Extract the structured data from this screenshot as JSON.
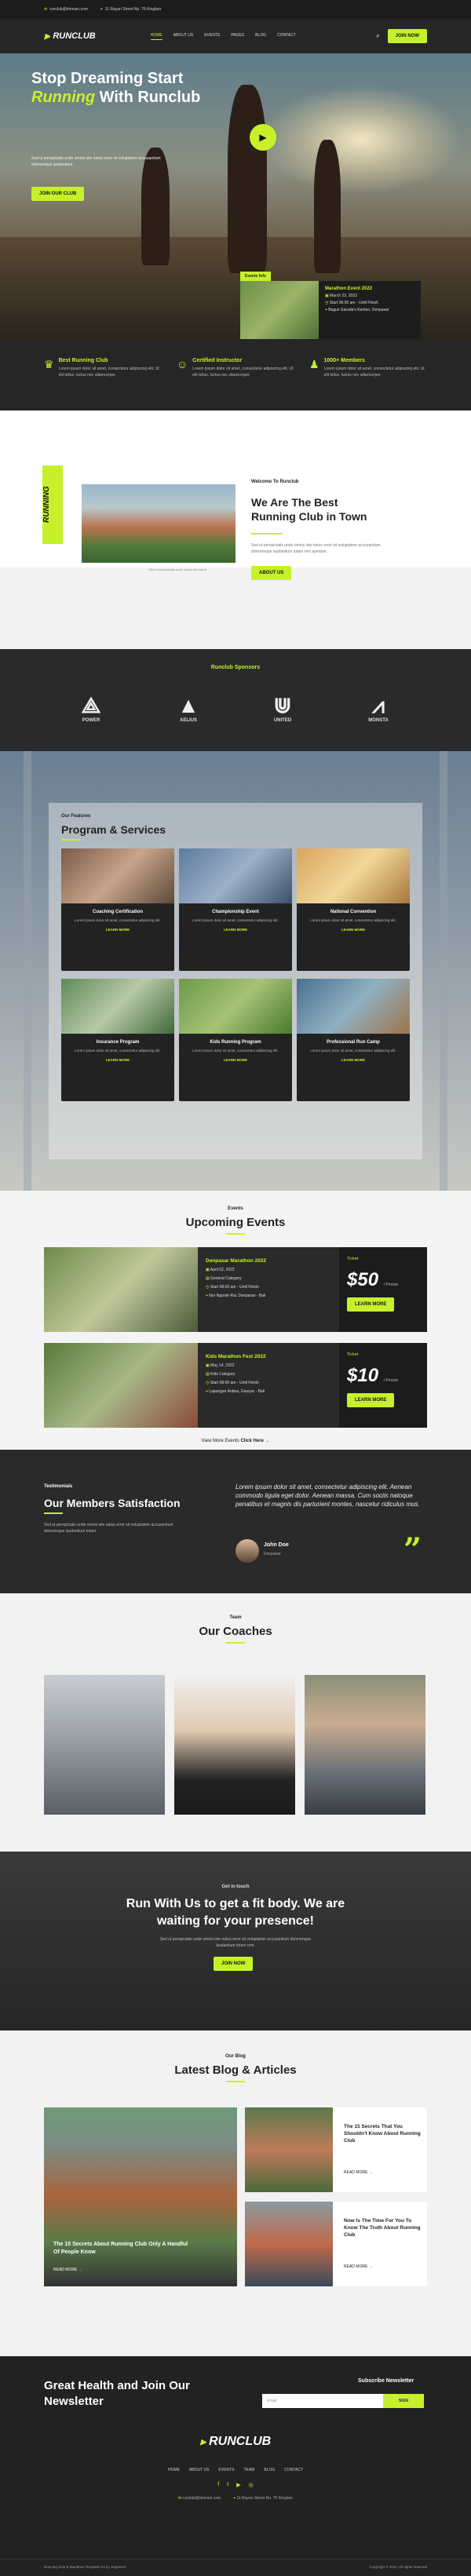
{
  "topbar": {
    "email": "runclub@domain.com",
    "address": "11 Rayan Street No. 76 Kinglaro"
  },
  "nav": {
    "logo": "RUNCLUB",
    "items": [
      "HOME",
      "ABOUT US",
      "EVENTS",
      "PAGES",
      "BLOG",
      "CONTACT"
    ],
    "cta": "JOIN NOW"
  },
  "hero": {
    "title_a": "Stop Dreaming Start",
    "title_em": "Running",
    "title_b": "With Runclub",
    "desc": "Sed ut perspiciatis unde omnis iste natus error sit voluptatem accusantium doloremque laudantium.",
    "button": "JOIN OUR CLUB"
  },
  "event_card": {
    "tag": "Events Info",
    "title": "Marathon Event 2022",
    "date": "March 23, 2022",
    "time": "Start 06:00 am - Until Finish",
    "place": "Bagus Garuda's Kenten, Denpasar"
  },
  "features": [
    {
      "title": "Best Running Club",
      "desc": "Lorem ipsum dolor sit amet, consectetur adipiscing elit. Ut elit tellus, luctus nec ullamcorper."
    },
    {
      "title": "Certified Instructor",
      "desc": "Lorem ipsum dolor sit amet, consectetur adipiscing elit. Ut elit tellus, luctus nec ullamcorper."
    },
    {
      "title": "1000+ Members",
      "desc": "Lorem ipsum dolor sit amet, consectetur adipiscing elit. Ut elit tellus, luctus nec ullamcorper."
    }
  ],
  "about": {
    "vertical": "RUNNING",
    "small": "Welcome To Runclub",
    "title": "We Are The Best Running Club in Town",
    "desc": "Sed ut perspiciatis unde omnis iste natus error sit voluptatem accusantium doloremque laudantium totam rem aperiam.",
    "caption": "Sed ut perspiciatis unde omnis iste natus",
    "button": "ABOUT US"
  },
  "sponsors": {
    "title": "Runclub Sponsors",
    "items": [
      "POWER",
      "AELIUS",
      "UNITED",
      "MONSTA"
    ]
  },
  "program": {
    "small": "Our Features",
    "title": "Program & Services",
    "cards": [
      {
        "title": "Coaching Certification",
        "desc": "Lorem ipsum dolor sit amet, consectetur adipiscing elit.",
        "more": "LEARN MORE"
      },
      {
        "title": "Championship Event",
        "desc": "Lorem ipsum dolor sit amet, consectetur adipiscing elit.",
        "more": "LEARN MORE"
      },
      {
        "title": "National Convention",
        "desc": "Lorem ipsum dolor sit amet, consectetur adipiscing elit.",
        "more": "LEARN MORE"
      },
      {
        "title": "Insurance Program",
        "desc": "Lorem ipsum dolor sit amet, consectetur adipiscing elit.",
        "more": "LEARN MORE"
      },
      {
        "title": "Kids Running Program",
        "desc": "Lorem ipsum dolor sit amet, consectetur adipiscing elit.",
        "more": "LEARN MORE"
      },
      {
        "title": "Professional Run Camp",
        "desc": "Lorem ipsum dolor sit amet, consectetur adipiscing elit.",
        "more": "LEARN MORE"
      }
    ]
  },
  "upcoming": {
    "small": "Events",
    "title": "Upcoming Events",
    "events": [
      {
        "title": "Denpasar Marathon 2022",
        "date": "April 02, 2022",
        "category": "General Category",
        "time": "Start 06:00 am - Until Finish",
        "place": "Nur Ngurah Rai, Denpasar - Bali",
        "ticket": "Ticket",
        "price": "$50",
        "per": "/ Person",
        "button": "LEARN MORE"
      },
      {
        "title": "Kids Marathon Fest 2022",
        "date": "May 14, 2022",
        "category": "Kids Category",
        "time": "Start 06:00 am - Until Finish",
        "place": "Lapangan Ardina, Gianyar - Bali",
        "ticket": "Ticket",
        "price": "$10",
        "per": "/ Person",
        "button": "LEARN MORE"
      }
    ],
    "more": "View More Events",
    "more_link": "Click Here"
  },
  "testimonials": {
    "small": "Testimonials",
    "title": "Our Members Satisfaction",
    "desc": "Sed ut perspiciatis unde omnis iste natus error sit voluptatem accusantium doloremque laudantium totam.",
    "quote": "Lorem ipsum dolor sit amet, consectetur adipiscing elit. Aenean commodo ligula eget dolor. Aenean massa. Cum sociis natoque penatibus et magnis dis parturient montes, nascetur ridiculus mus.",
    "name": "John Doe",
    "role": "Denpasar"
  },
  "coaches": {
    "small": "Team",
    "title": "Our Coaches"
  },
  "cta": {
    "small": "Get in touch",
    "title": "Run With Us to get a fit body. We are waiting for your presence!",
    "desc": "Sed ut perspiciatis unde omnis iste natus error sit voluptatem accusantium doloremque laudantium totam rem.",
    "button": "JOIN NOW"
  },
  "blog": {
    "small": "Our Blog",
    "title": "Latest Blog & Articles",
    "main": {
      "title": "The 15 Secrets About Running Club Only A Handful Of People Know",
      "more": "READ MORE"
    },
    "side": [
      {
        "title": "The 15 Secrets That You Shouldn't Know About Running Club",
        "more": "READ MORE"
      },
      {
        "title": "Now Is The Time For You To Know The Truth About Running Club",
        "more": "READ MORE"
      }
    ]
  },
  "footer": {
    "title": "Great Health and Join Our Newsletter",
    "sub_label": "Subscribe Newsletter",
    "placeholder": "Email",
    "sub_button": "SIGN",
    "menu": [
      "HOME",
      "ABOUT US",
      "EVENTS",
      "TEAM",
      "BLOG",
      "CONTACT"
    ],
    "email": "runclub@domain.com",
    "address": "11 Rayan Street No. 76 Kinglaro",
    "left": "Running Club & Marathon Template Kit by Jegtheme",
    "right": "Copyright © 2022. All rights reserved"
  }
}
